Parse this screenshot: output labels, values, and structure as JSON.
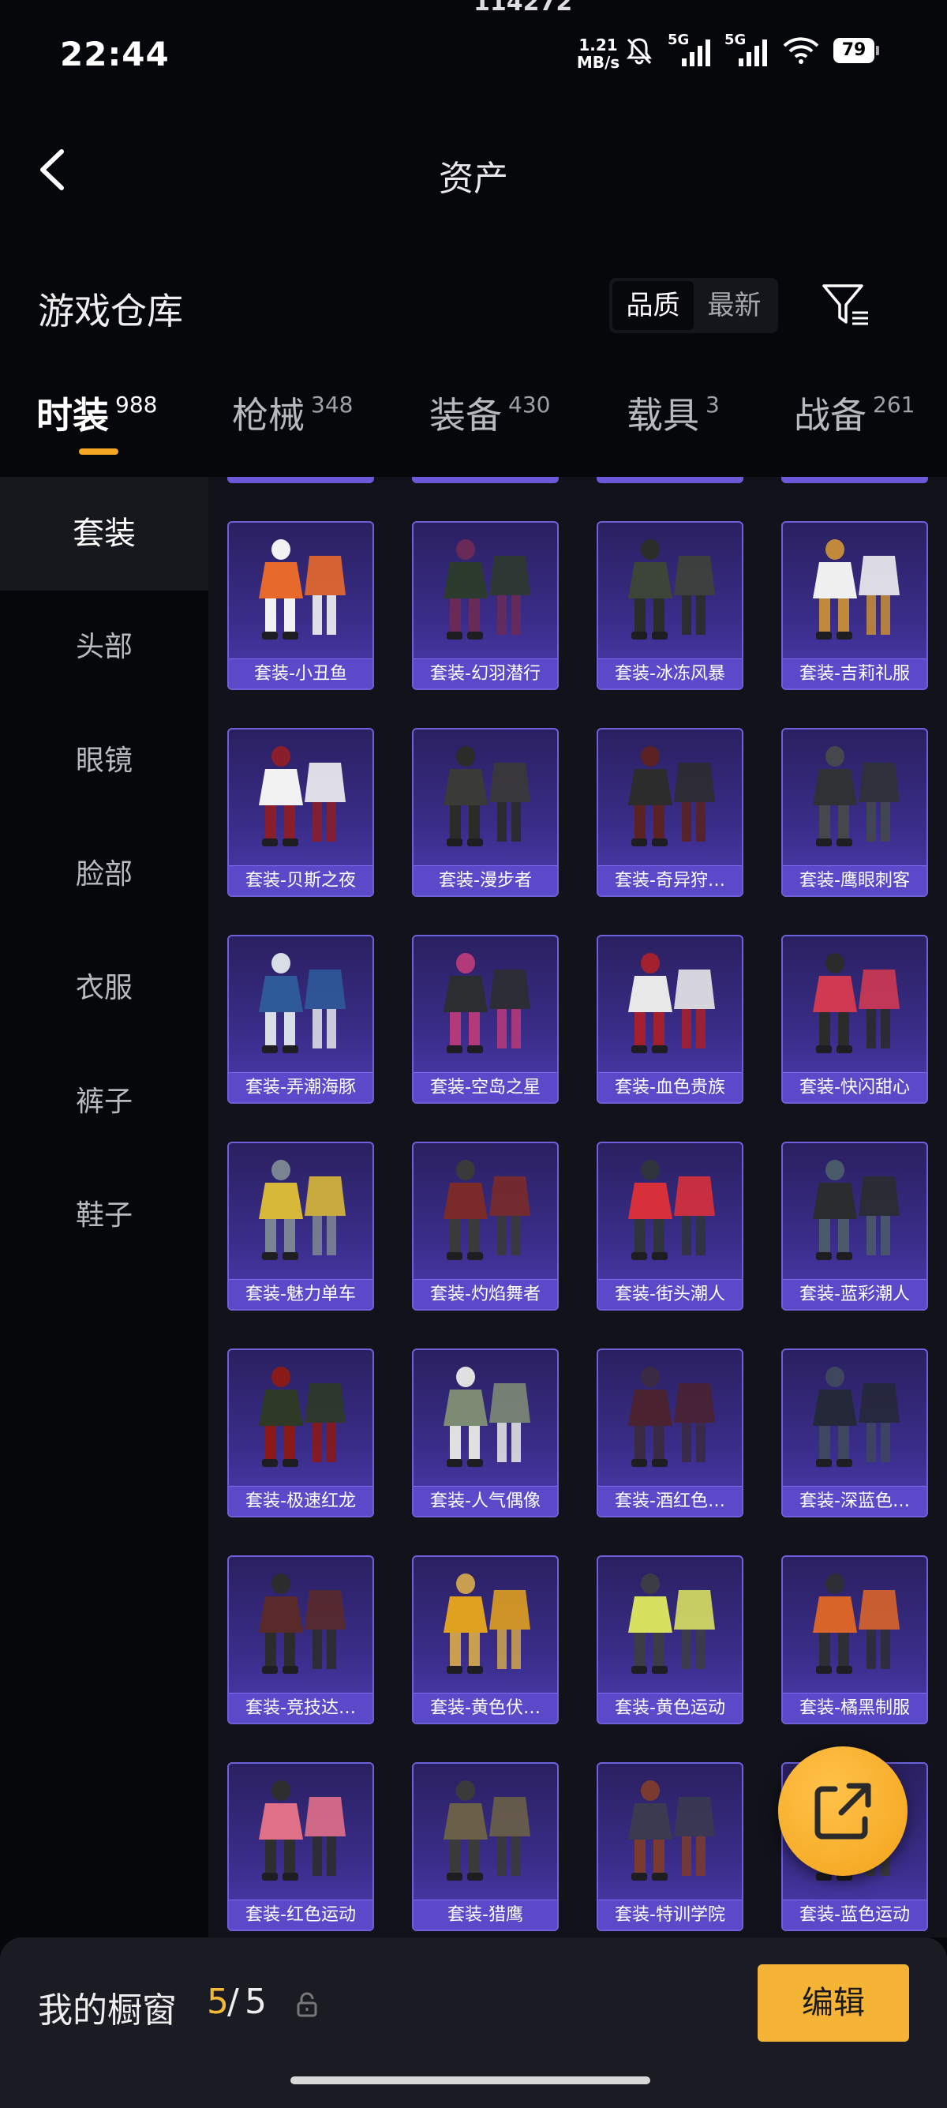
{
  "status": {
    "time": "22:44",
    "top_number": "114272",
    "speed": "1.21\nMB/s",
    "signal_label": "5G",
    "battery": "79"
  },
  "header": {
    "title": "资产"
  },
  "section": {
    "title": "游戏仓库",
    "sort_options": [
      "品质",
      "最新"
    ],
    "active_sort": "品质"
  },
  "tabs": [
    {
      "name": "时装",
      "count": "988"
    },
    {
      "name": "枪械",
      "count": "348"
    },
    {
      "name": "装备",
      "count": "430"
    },
    {
      "name": "载具",
      "count": "3"
    },
    {
      "name": "战备",
      "count": "261"
    }
  ],
  "sidebar": {
    "items": [
      "套装",
      "头部",
      "眼镜",
      "脸部",
      "衣服",
      "裤子",
      "鞋子"
    ]
  },
  "items": [
    "套装-小丑鱼",
    "套装-幻羽潜行",
    "套装-冰冻风暴",
    "套装-吉莉礼服",
    "套装-贝斯之夜",
    "套装-漫步者",
    "套装-奇异狩…",
    "套装-鹰眼刺客",
    "套装-弄潮海豚",
    "套装-空岛之星",
    "套装-血色贵族",
    "套装-快闪甜心",
    "套装-魅力单车",
    "套装-灼焰舞者",
    "套装-街头潮人",
    "套装-蓝彩潮人",
    "套装-极速红龙",
    "套装-人气偶像",
    "套装-酒红色…",
    "套装-深蓝色…",
    "套装-竞技达…",
    "套装-黄色伏…",
    "套装-黄色运动",
    "套装-橘黑制服",
    "套装-红色运动",
    "套装-猎鹰",
    "套装-特训学院",
    "套装-蓝色运动"
  ],
  "showcase": {
    "label": "我的橱窗",
    "current": "5",
    "slash": "/",
    "total": "5",
    "edit_label": "编辑"
  },
  "colors": {
    "accent": "#f5a623",
    "card": "#4c3cb0",
    "label_bg": "#5a49c8"
  }
}
